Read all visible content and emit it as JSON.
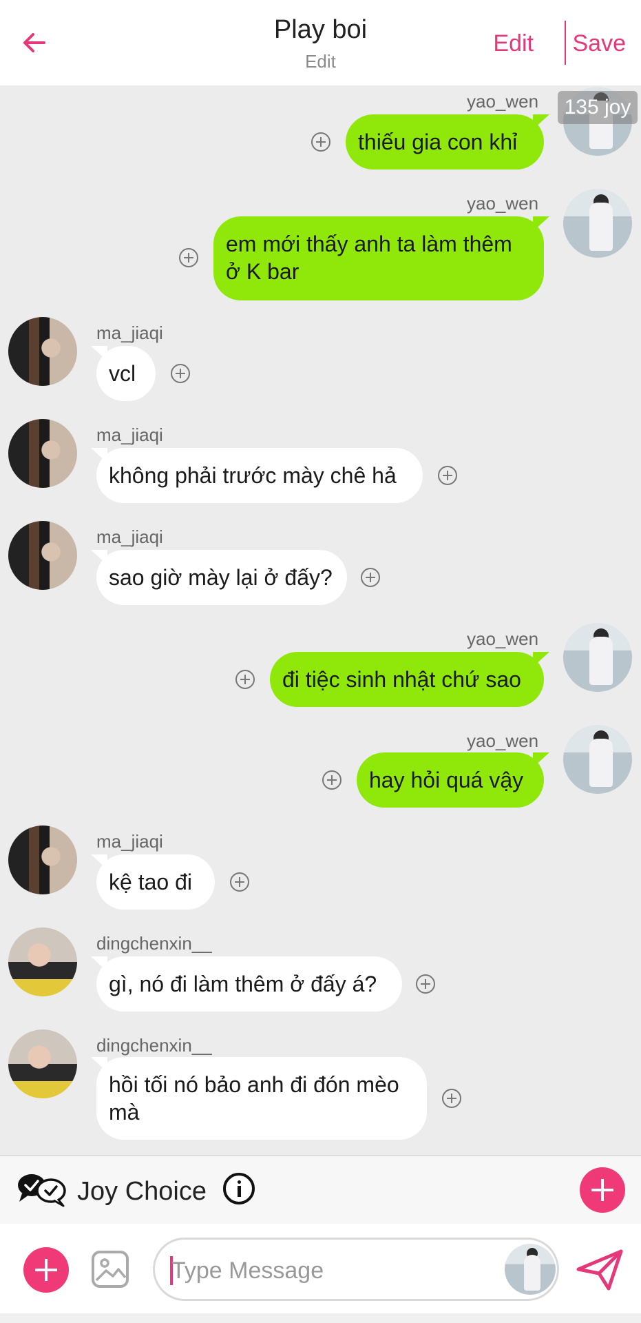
{
  "header": {
    "title": "Play boi",
    "subtitle": "Edit",
    "edit_label": "Edit",
    "save_label": "Save"
  },
  "joy_badge": "135 joy",
  "messages": [
    {
      "sender": "yao_wen",
      "text": "thiếu gia con khỉ",
      "side": "right",
      "avatar": "yao_wen"
    },
    {
      "sender": "yao_wen",
      "text": "em mới thấy anh ta làm thêm ở K bar",
      "side": "right",
      "avatar": "yao_wen"
    },
    {
      "sender": "ma_jiaqi",
      "text": "vcl",
      "side": "left",
      "avatar": "ma_jiaqi"
    },
    {
      "sender": "ma_jiaqi",
      "text": "không phải trước mày chê hả",
      "side": "left",
      "avatar": "ma_jiaqi"
    },
    {
      "sender": "ma_jiaqi",
      "text": "sao giờ mày lại ở đấy?",
      "side": "left",
      "avatar": "ma_jiaqi"
    },
    {
      "sender": "yao_wen",
      "text": "đi tiệc sinh nhật chứ sao",
      "side": "right",
      "avatar": "yao_wen"
    },
    {
      "sender": "yao_wen",
      "text": "hay hỏi quá vậy",
      "side": "right",
      "avatar": "yao_wen"
    },
    {
      "sender": "ma_jiaqi",
      "text": "kệ tao đi",
      "side": "left",
      "avatar": "ma_jiaqi"
    },
    {
      "sender": "dingchenxin__",
      "text": "gì, nó đi làm thêm ở đấy á?",
      "side": "left",
      "avatar": "dingchenxin__"
    },
    {
      "sender": "dingchenxin__",
      "text": "hồi tối nó bảo anh đi đón mèo mà",
      "side": "left",
      "avatar": "dingchenxin__"
    }
  ],
  "joy_choice": {
    "label": "Joy Choice"
  },
  "composer": {
    "placeholder": "Type Message"
  },
  "colors": {
    "accent": "#e5387a",
    "outgoing_bubble": "#8fe80a",
    "incoming_bubble": "#ffffff",
    "background": "#ececec"
  },
  "icons": [
    "back-arrow-icon",
    "add-circle-icon",
    "info-icon",
    "chat-bubbles-icon",
    "image-icon",
    "send-icon"
  ]
}
